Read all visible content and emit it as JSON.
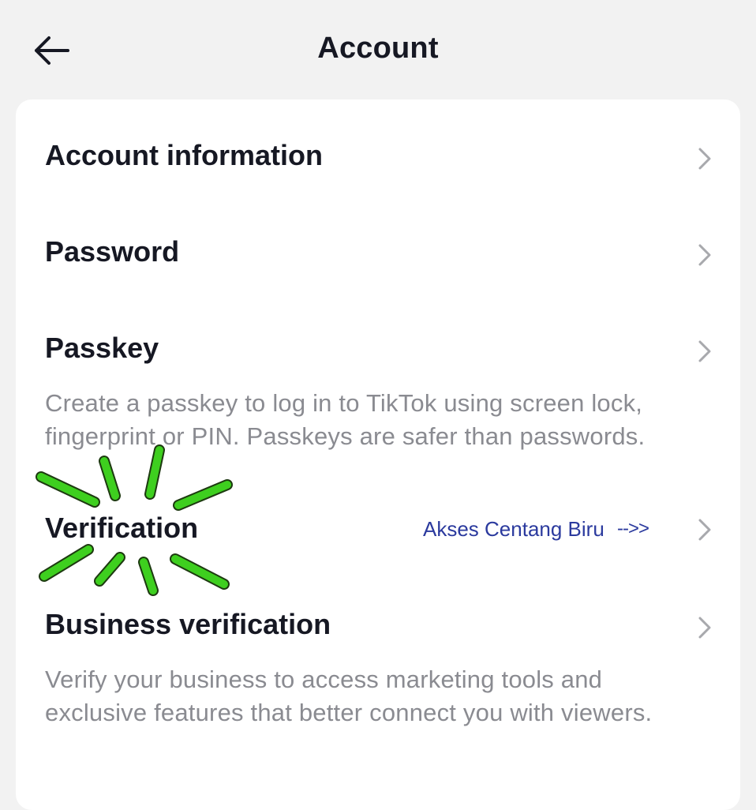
{
  "header": {
    "title": "Account",
    "back_icon": "arrow-left-icon"
  },
  "rows": [
    {
      "label": "Account information",
      "chevron_icon": "chevron-right-icon"
    },
    {
      "label": "Password",
      "chevron_icon": "chevron-right-icon"
    },
    {
      "label": "Passkey",
      "description": "Create a passkey to log in to TikTok using screen lock, fingerprint or PIN. Passkeys are safer than passwords.",
      "chevron_icon": "chevron-right-icon"
    },
    {
      "label": "Verification",
      "annotation": "Akses Centang Biru",
      "annotation_arrow": "-->>",
      "chevron_icon": "chevron-right-icon"
    },
    {
      "label": "Business verification",
      "description": "Verify your business to access marketing tools and exclusive features that better connect you with viewers.",
      "chevron_icon": "chevron-right-icon"
    }
  ],
  "colors": {
    "background": "#f2f2f2",
    "card": "#ffffff",
    "text_primary": "#161823",
    "text_secondary": "#8a8b91",
    "chevron": "#a8a9ad",
    "annotation_text": "#2b3a9e",
    "highlight_marks": "#3ecf1f"
  }
}
